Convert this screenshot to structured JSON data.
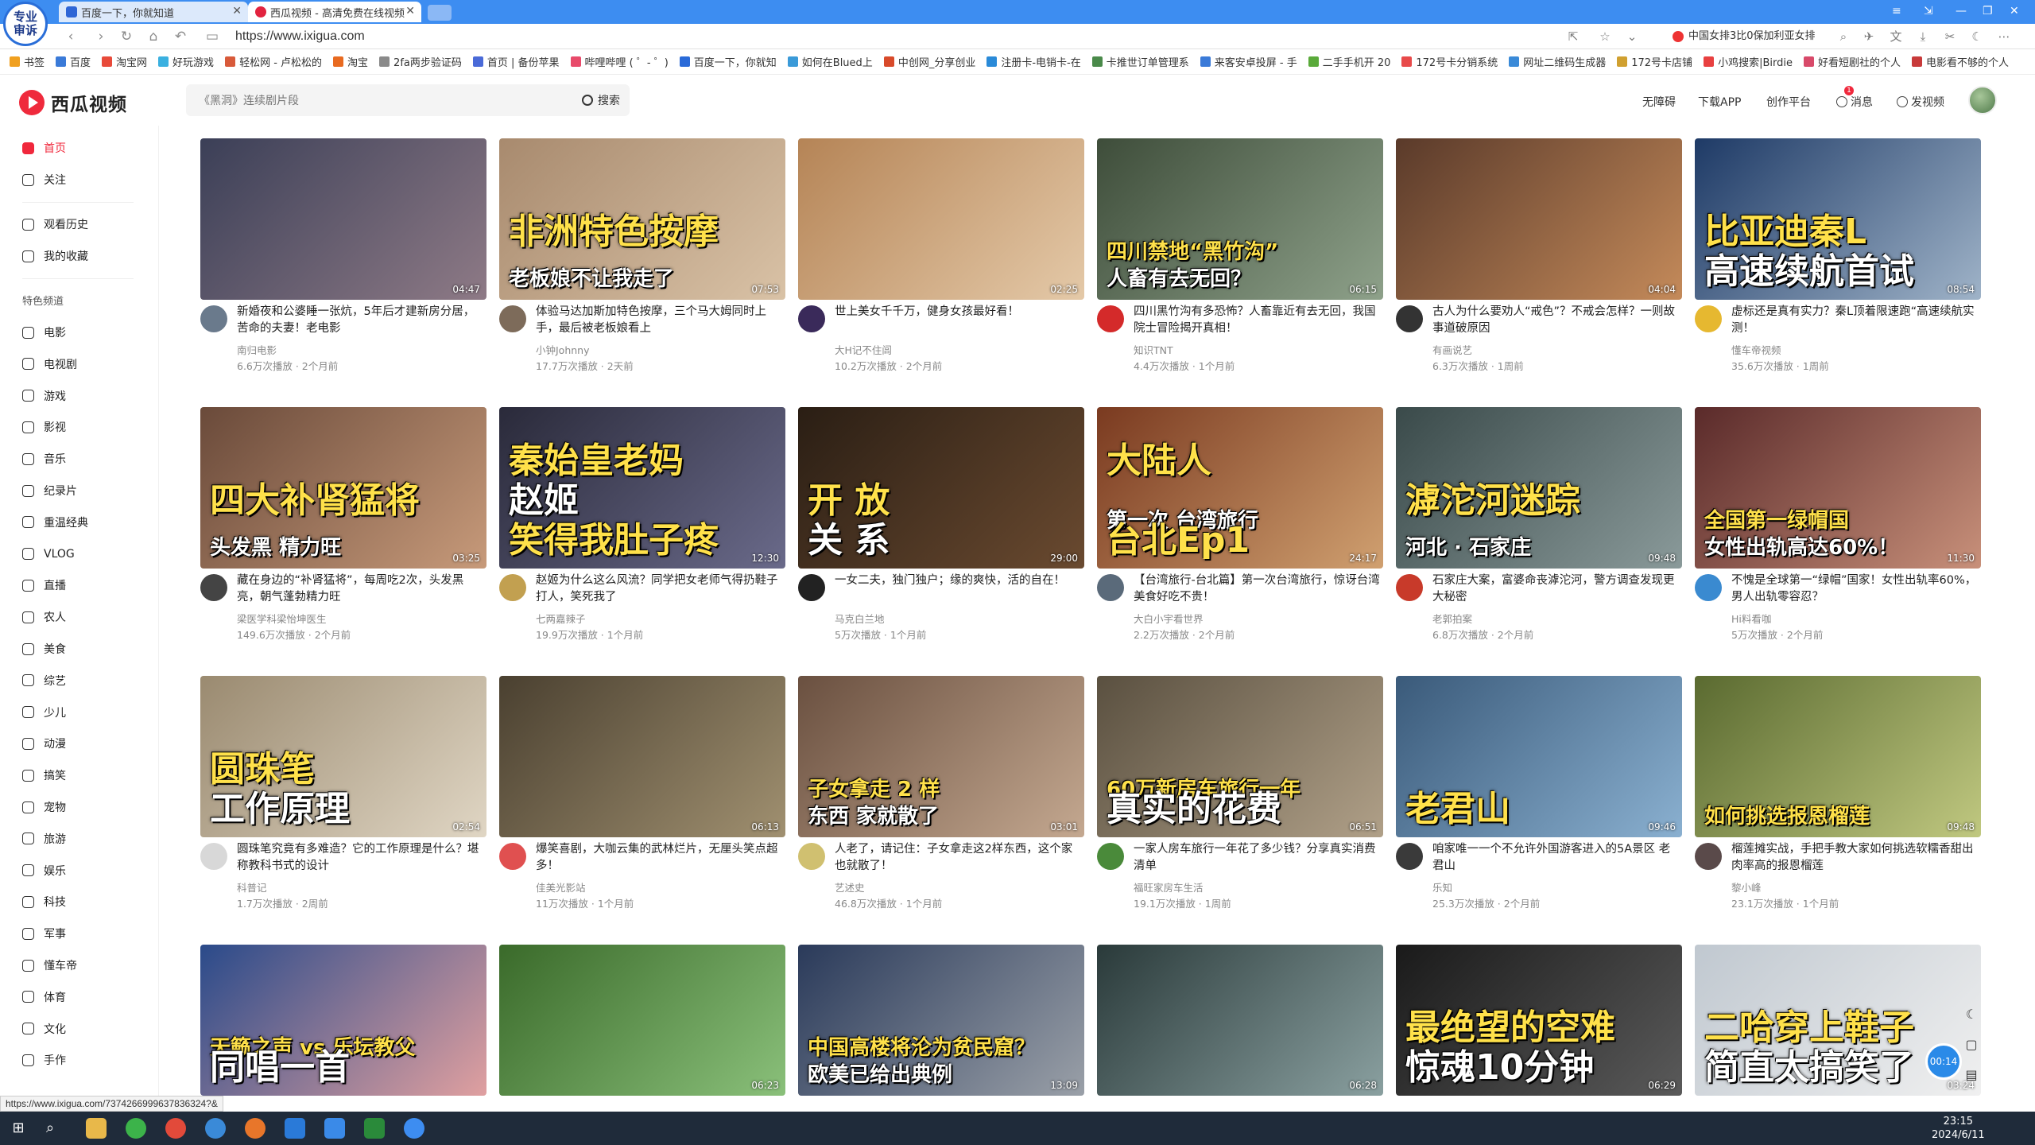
{
  "browser": {
    "logo_text_1": "专业",
    "logo_text_2": "审诉",
    "tabs": [
      {
        "title": "百度一下，你就知道"
      },
      {
        "title": "西瓜视频 - 高清免费在线视频"
      }
    ],
    "url": "https://www.ixigua.com",
    "right_search": "中国女排3比0保加利亚女排",
    "bookmarks": [
      "书签",
      "百度",
      "淘宝网",
      "好玩游戏",
      "轻松网 - 卢松松的",
      "淘宝",
      "2fa两步验证码",
      "首页 | 备份苹果",
      "哔哩哔哩 ( ゜- ゜)",
      "百度一下，你就知",
      "如何在Blued上",
      "中创网_分享创业",
      "注册卡-电销卡-在",
      "卡推世订单管理系",
      "来客安卓投屏 - 手",
      "二手手机开 20",
      "172号卡分销系统",
      "网址二维码生成器",
      "172号卡店铺",
      "小鸡搜索|Birdie",
      "好看短剧社的个人",
      "电影看不够的个人"
    ],
    "status_url": "https://www.ixigua.com/7374266999637836324?&"
  },
  "site": {
    "logo": "西瓜视频",
    "search_placeholder": "《黑洞》连续剧片段",
    "search_button": "搜索",
    "header_links": {
      "accessibility": "无障碍",
      "download": "下载APP",
      "creator": "创作平台",
      "message": "消息",
      "message_count": "1",
      "upload": "发视频"
    }
  },
  "sidebar": {
    "primary": [
      "首页",
      "关注"
    ],
    "secondary": [
      "观看历史",
      "我的收藏"
    ],
    "section_title": "特色频道",
    "channels": [
      "电影",
      "电视剧",
      "游戏",
      "影视",
      "音乐",
      "纪录片",
      "重温经典",
      "VLOG",
      "直播",
      "农人",
      "美食",
      "综艺",
      "少儿",
      "动漫",
      "搞笑",
      "宠物",
      "旅游",
      "娱乐",
      "科技",
      "军事",
      "懂车帝",
      "体育",
      "文化",
      "手作"
    ]
  },
  "videos": [
    {
      "title": "新婚夜和公婆睡一张炕，5年后才建新房分居，苦命的夫妻！老电影",
      "author": "南归电影",
      "stats": "6.6万次播放 · 2个月前",
      "duration": "04:47",
      "caption": "",
      "bg": [
        "#3b3f57",
        "#8e7a86"
      ],
      "avatar_color": "#6a7a8c"
    },
    {
      "title": "体验马达加斯加特色按摩，三个马大姆同时上手，最后被老板娘看上",
      "author": "小钟Johnny",
      "stats": "17.7万次播放 · 2天前",
      "duration": "07:53",
      "caption": "非洲特色按摩|老板娘不让我走了",
      "bg": [
        "#a88a6e",
        "#d9c2a6"
      ],
      "avatar_color": "#7d6b5a"
    },
    {
      "title": "世上美女千千万，健身女孩最好看！",
      "author": "大H记不住闾",
      "stats": "10.2万次播放 · 2个月前",
      "duration": "02:25",
      "caption": "",
      "bg": [
        "#b58456",
        "#e4c9a8"
      ],
      "avatar_color": "#3a2a5a"
    },
    {
      "title": "四川黑竹沟有多恐怖？人畜靠近有去无回，我国院士冒险揭开真相！",
      "author": "知识TNT",
      "stats": "4.4万次播放 · 1个月前",
      "duration": "06:15",
      "caption": "四川禁地“黑竹沟”|人畜有去无回？",
      "bg": [
        "#3e4d3a",
        "#8ea18a"
      ],
      "avatar_color": "#d42a2a"
    },
    {
      "title": "古人为什么要劝人“戒色”？不戒会怎样？一则故事道破原因",
      "author": "有画说艺",
      "stats": "6.3万次播放 · 1周前",
      "duration": "04:04",
      "caption": "",
      "bg": [
        "#5a3a2a",
        "#c48a5a"
      ],
      "avatar_color": "#333333"
    },
    {
      "title": "虚标还是真有实力？秦L顶着限速跑“高速续航实测！",
      "author": "懂车帝视频",
      "stats": "35.6万次播放 · 1周前",
      "duration": "08:54",
      "caption": "比亚迪秦L|高速续航首试",
      "bg": [
        "#1e3a66",
        "#9fb3c8"
      ],
      "avatar_color": "#e6b830"
    },
    {
      "title": "藏在身边的“补肾猛将”，每周吃2次，头发黑亮，朝气蓬勃精力旺",
      "author": "梁医学科梁怡坤医生",
      "stats": "149.6万次播放 · 2个月前",
      "duration": "03:25",
      "caption": "四大补肾猛将|头发黑 精力旺",
      "bg": [
        "#6a4a3a",
        "#c79a7a"
      ],
      "avatar_color": "#444444"
    },
    {
      "title": "赵姬为什么这么风流？同学把女老师气得扔鞋子打人，笑死我了",
      "author": "七两嘉辣子",
      "stats": "19.9万次播放 · 1个月前",
      "duration": "12:30",
      "caption": "秦始皇老妈|赵姬|笑得我肚子疼",
      "bg": [
        "#2a2a3a",
        "#6a6a8a"
      ],
      "avatar_color": "#c2a050"
    },
    {
      "title": "一女二夫，独门独户；缘的爽快，活的自在！",
      "author": "马克白兰地",
      "stats": "5万次播放 · 1个月前",
      "duration": "29:00",
      "caption": "开 放|关 系",
      "bg": [
        "#2a1e14",
        "#6a4a30"
      ],
      "avatar_color": "#222222"
    },
    {
      "title": "【台湾旅行-台北篇】第一次台湾旅行，惊讶台湾美食好吃不贵！",
      "author": "大白小宇看世界",
      "stats": "2.2万次播放 · 2个月前",
      "duration": "24:17",
      "caption": "大陆人|第一次 台湾旅行|台北Ep1",
      "bg": [
        "#7a3a20",
        "#d0a070"
      ],
      "avatar_color": "#5a6a7a"
    },
    {
      "title": "石家庄大案，富婆命丧滹沱河，警方调查发现更大秘密",
      "author": "老郭拍案",
      "stats": "6.8万次播放 · 2个月前",
      "duration": "09:48",
      "caption": "滹沱河迷踪|河北 · 石家庄",
      "bg": [
        "#3a4a4a",
        "#8a9a9a"
      ],
      "avatar_color": "#c83a2a"
    },
    {
      "title": "不愧是全球第一“绿帽”国家！女性出轨率60%，男人出轨零容忍？",
      "author": "Hi料看咖",
      "stats": "5万次播放 · 2个月前",
      "duration": "11:30",
      "caption": "全国第一绿帽国|女性出轨高达60%！",
      "bg": [
        "#5a2a2a",
        "#c8907a"
      ],
      "avatar_color": "#3a8ad0"
    },
    {
      "title": "圆珠笔究竟有多难造？它的工作原理是什么？堪称教科书式的设计",
      "author": "科普记",
      "stats": "1.7万次播放 · 2周前",
      "duration": "02:54",
      "caption": "圆珠笔|工作原理",
      "bg": [
        "#9a8a70",
        "#e0d6c4"
      ],
      "avatar_color": "#d8d8d8"
    },
    {
      "title": "爆笑喜剧，大咖云集的武林烂片，无厘头笑点超多！",
      "author": "佳美光影站",
      "stats": "11万次播放 · 1个月前",
      "duration": "06:13",
      "caption": "",
      "bg": [
        "#4a4030",
        "#a09070"
      ],
      "avatar_color": "#e05050"
    },
    {
      "title": "人老了，请记住：子女拿走这2样东西，这个家也就散了！",
      "author": "艺述史",
      "stats": "46.8万次播放 · 1个月前",
      "duration": "03:01",
      "caption": "子女拿走 2 样|东西 家就散了",
      "bg": [
        "#6a5040",
        "#c4a890"
      ],
      "avatar_color": "#d0c070"
    },
    {
      "title": "一家人房车旅行一年花了多少钱？分享真实消费清单",
      "author": "福旺家房车生活",
      "stats": "19.1万次播放 · 1周前",
      "duration": "06:51",
      "caption": "60万新房车旅行一年|真实的花费",
      "bg": [
        "#5a5040",
        "#b0a088"
      ],
      "avatar_color": "#4a8a3a"
    },
    {
      "title": "咱家唯一一个不允许外国游客进入的5A景区 老君山",
      "author": "乐知",
      "stats": "25.3万次播放 · 2个月前",
      "duration": "09:46",
      "caption": "老君山",
      "bg": [
        "#3a5a7a",
        "#8ab0d0"
      ],
      "avatar_color": "#3a3a3a"
    },
    {
      "title": "榴莲摊实战，手把手教大家如何挑选软糯香甜出肉率高的报恩榴莲",
      "author": "黎小峰",
      "stats": "23.1万次播放 · 1个月前",
      "duration": "09:48",
      "caption": "如何挑选报恩榴莲",
      "bg": [
        "#5a6a30",
        "#c0c880"
      ],
      "avatar_color": "#5a4a4a"
    },
    {
      "title": "",
      "author": "",
      "stats": "",
      "duration": "",
      "caption": "天籁之声 vs 乐坛教父|同唱一首",
      "bg": [
        "#2a4a8a",
        "#e0a0a0"
      ],
      "avatar_color": "#ffffff"
    },
    {
      "title": "",
      "author": "",
      "stats": "",
      "duration": "06:23",
      "caption": "",
      "bg": [
        "#3a6a2a",
        "#8ac07a"
      ],
      "avatar_color": "#ffffff"
    },
    {
      "title": "",
      "author": "",
      "stats": "",
      "duration": "13:09",
      "caption": "中国高楼将沦为贫民窟？|欧美已给出典例",
      "bg": [
        "#2a3a5a",
        "#9aa0a8"
      ],
      "avatar_color": "#ffffff"
    },
    {
      "title": "",
      "author": "",
      "stats": "",
      "duration": "06:28",
      "caption": "",
      "bg": [
        "#2a3a3a",
        "#8aa0a0"
      ],
      "avatar_color": "#ffffff"
    },
    {
      "title": "",
      "author": "",
      "stats": "",
      "duration": "06:29",
      "caption": "最绝望的空难|惊魂10分钟",
      "bg": [
        "#1a1a1a",
        "#5a5a5a"
      ],
      "avatar_color": "#ffffff"
    },
    {
      "title": "",
      "author": "",
      "stats": "",
      "duration": "03:24",
      "caption": "二哈穿上鞋子|简直太搞笑了",
      "bg": [
        "#c0c8d0",
        "#f0f0f0"
      ],
      "avatar_color": "#ffffff"
    }
  ],
  "taskbar": {
    "time": "23:15",
    "date": "2024/6/11"
  },
  "floating": {
    "timer": "00:14"
  }
}
